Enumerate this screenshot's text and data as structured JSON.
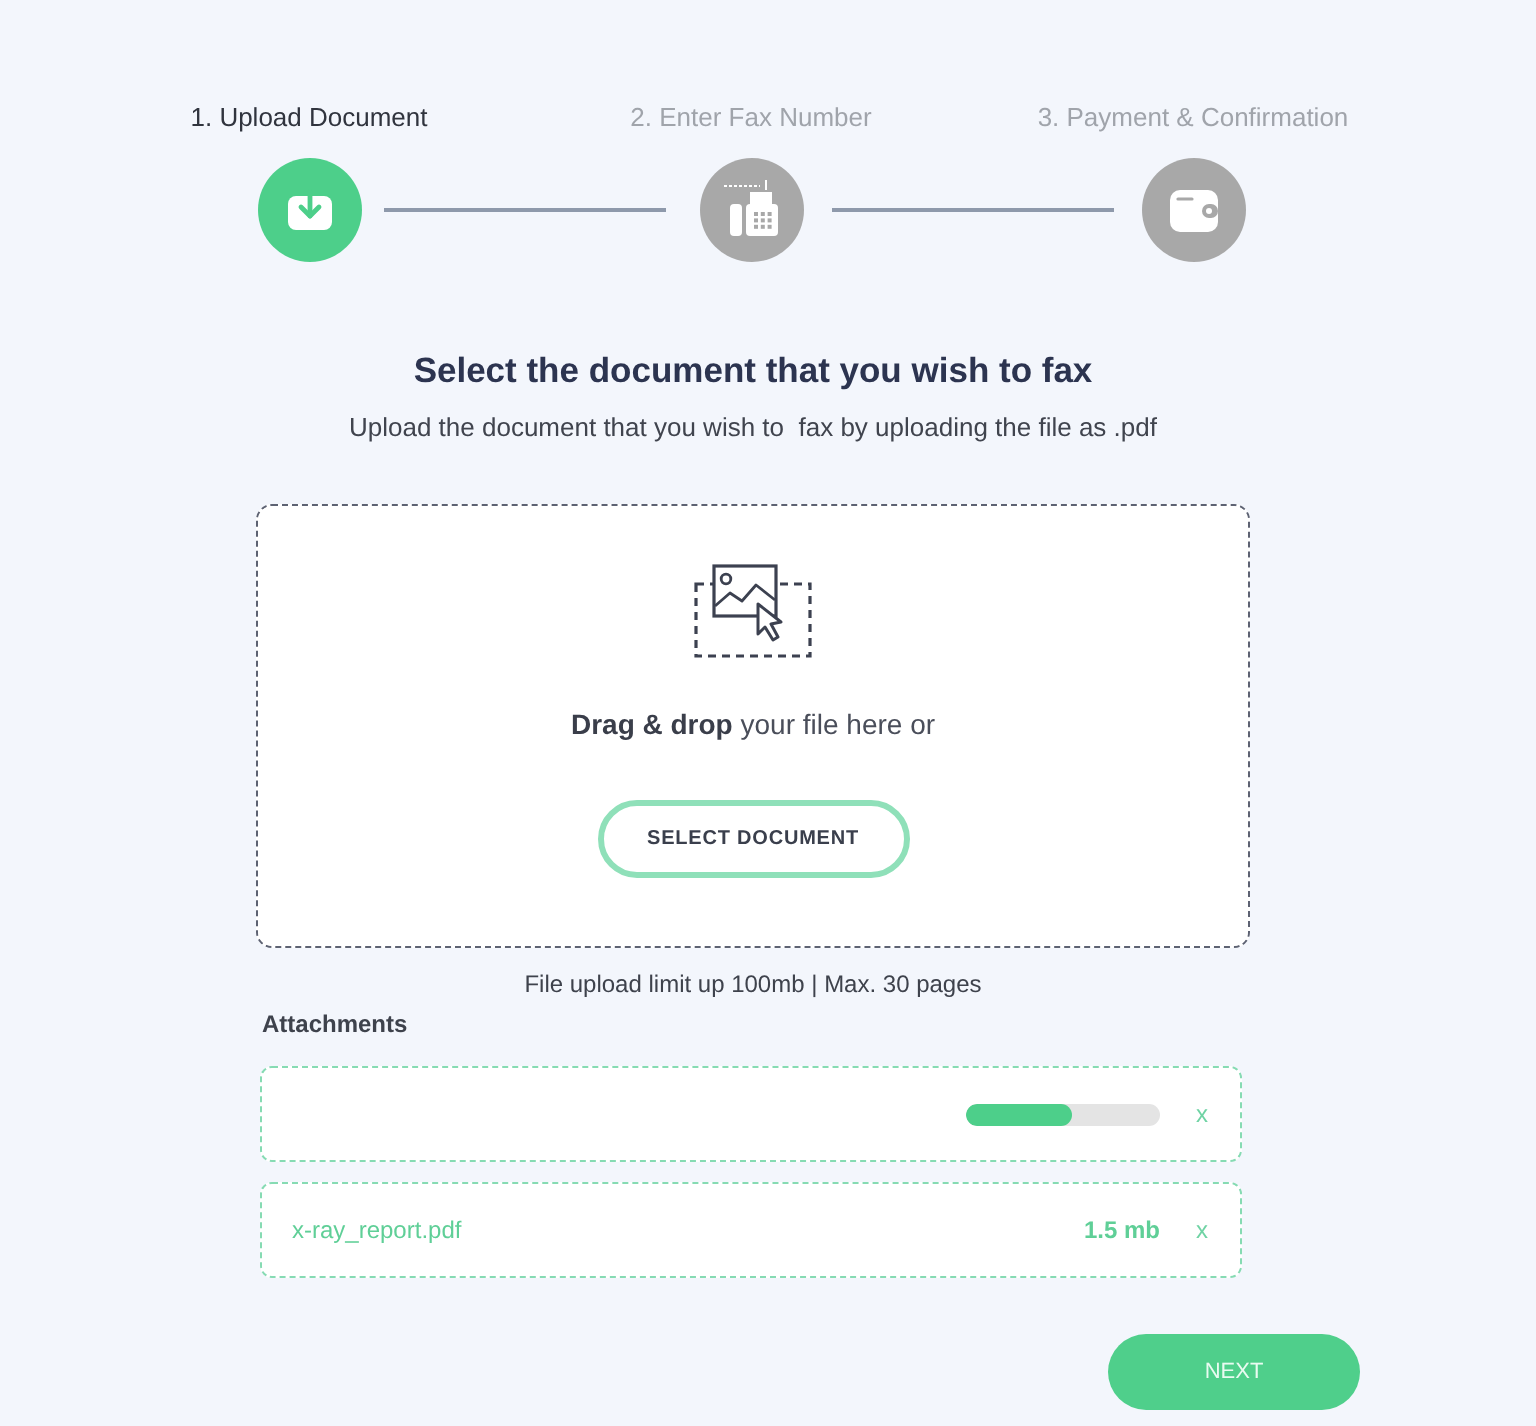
{
  "steps": [
    {
      "label": "1. Upload Document",
      "selected": true
    },
    {
      "label": "2. Enter Fax Number",
      "selected": false
    },
    {
      "label": "3. Payment & Confirmation",
      "selected": false
    }
  ],
  "heading": "Select the document that you wish to fax",
  "subtitle": "Upload the document that you wish to  fax by uploading the file as .pdf",
  "dropzone": {
    "prompt": "**Drag & drop** your file here or",
    "button": "SELECT DOCUMENT"
  },
  "limit_note": "File upload limit up 100mb | Max. 30 pages",
  "attachments": {
    "title": "Attachments",
    "items": [
      {
        "kind": "uploading",
        "level": 0.55,
        "remove": "x"
      },
      {
        "kind": "file",
        "name": "x-ray_report.pdf",
        "size": "1.5 mb",
        "remove": "x"
      }
    ]
  },
  "next_button": "NEXT"
}
